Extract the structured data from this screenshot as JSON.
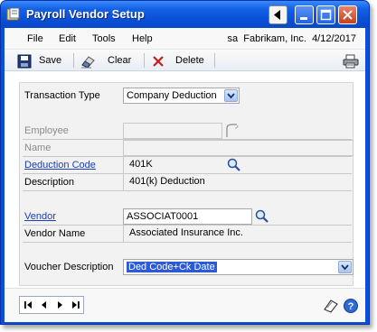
{
  "window": {
    "title": "Payroll Vendor Setup"
  },
  "menu": {
    "items": [
      "File",
      "Edit",
      "Tools",
      "Help"
    ],
    "user": "sa",
    "company": "Fabrikam, Inc.",
    "date": "4/12/2017"
  },
  "toolbar": {
    "save_label": "Save",
    "clear_label": "Clear",
    "delete_label": "Delete"
  },
  "form": {
    "transaction_type": {
      "label": "Transaction Type",
      "value": "Company Deduction"
    },
    "employee": {
      "label": "Employee",
      "value": ""
    },
    "name": {
      "label": "Name",
      "value": ""
    },
    "deduction_code": {
      "label": "Deduction Code",
      "value": "401K"
    },
    "description": {
      "label": "Description",
      "value": "401(k) Deduction"
    },
    "vendor": {
      "label": "Vendor",
      "value": "ASSOCIAT0001"
    },
    "vendor_name": {
      "label": "Vendor Name",
      "value": "Associated Insurance Inc."
    },
    "voucher_description": {
      "label": "Voucher Description",
      "value": "Ded Code+Ck Date"
    }
  },
  "colors": {
    "titlebar": "#0a4fd6",
    "link": "#1a3fb8",
    "selection": "#2a5ad7"
  }
}
